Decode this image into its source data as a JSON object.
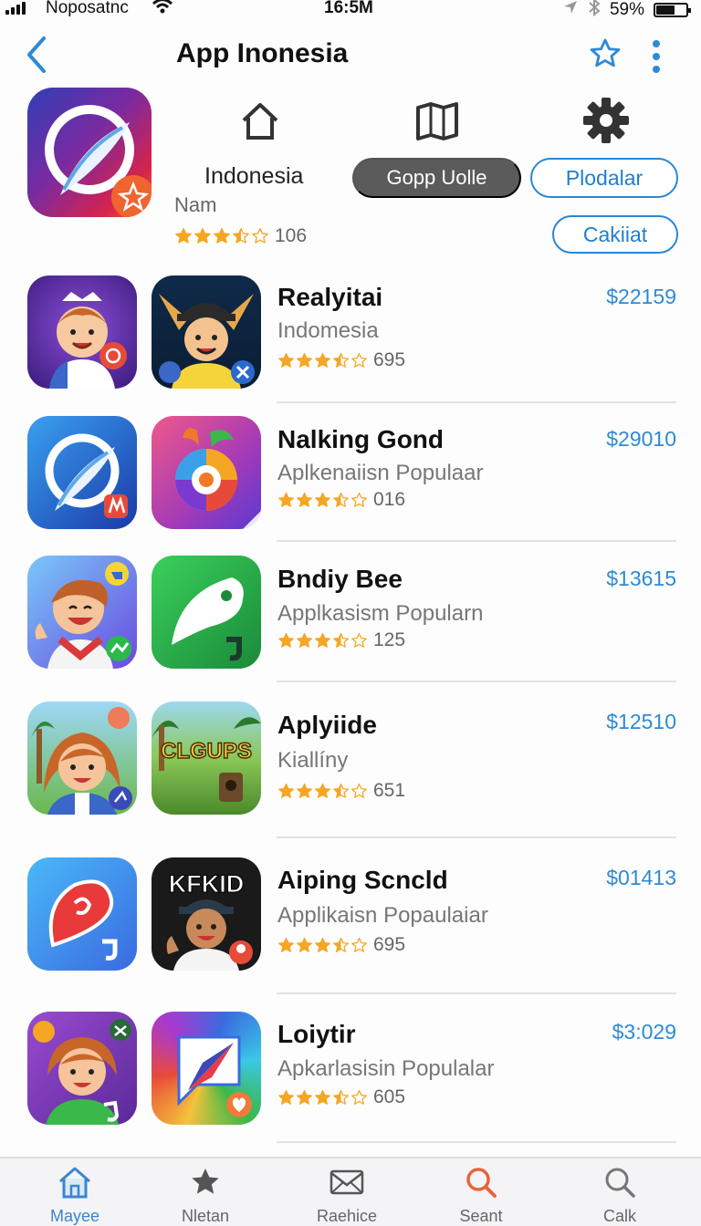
{
  "status_bar": {
    "carrier": "Noposatnc",
    "time": "16:5M",
    "battery": "59%",
    "icons": [
      "signal-icon",
      "wifi-icon",
      "location-icon",
      "bluetooth-icon",
      "battery-icon"
    ]
  },
  "nav": {
    "title": "App Inonesia",
    "icons": [
      "back-chevron-icon",
      "star-outline-icon",
      "more-vertical-icon"
    ]
  },
  "hero": {
    "name": "Indonesia",
    "subtitle": "Nam",
    "rating_count": "106",
    "rating": 3.5,
    "actions": {
      "dark_pill": "Gopp Uolle",
      "primary_outline": "Plodalar",
      "secondary_outline": "Cakiiat"
    },
    "icons": [
      "home-icon",
      "book-icon",
      "gear-icon"
    ]
  },
  "apps": [
    {
      "title": "Realyitai",
      "subtitle": "Indomesia",
      "rating_count": "695",
      "price": "$22159",
      "rating": 3.5
    },
    {
      "title": "Nalking Gond",
      "subtitle": "Aplkenaiisn Populaar",
      "rating_count": "016",
      "price": "$29010",
      "rating": 3.5
    },
    {
      "title": "Bndiy Bee",
      "subtitle": "Applkasism Popularn",
      "rating_count": "125",
      "price": "$13615",
      "rating": 3.5
    },
    {
      "title": "Aplyiide",
      "subtitle": "Kiallíny",
      "rating_count": "651",
      "price": "$12510",
      "rating": 3.5
    },
    {
      "title": "Aiping Scncld",
      "subtitle": "Applikaisn Popaulaiar",
      "rating_count": "695",
      "price": "$01413",
      "rating": 3.5
    },
    {
      "title": "Loiytir",
      "subtitle": "Apkarlasisin Populalar",
      "rating_count": "605",
      "price": "$3:029",
      "rating": 3.5
    }
  ],
  "icon_texts": {
    "clgups": "CLGUPS",
    "kfkid": "KFKID"
  },
  "tabs": [
    {
      "label": "Mayee",
      "icon": "home-icon",
      "active": true
    },
    {
      "label": "Nletan",
      "icon": "star-icon",
      "active": false
    },
    {
      "label": "Raehice",
      "icon": "mail-icon",
      "active": false
    },
    {
      "label": "Seant",
      "icon": "search-icon",
      "active": false
    },
    {
      "label": "Calk",
      "icon": "search-icon",
      "active": false
    }
  ],
  "colors": {
    "accent": "#2e8ad6",
    "star": "#f5a623",
    "tab_active": "#3a85d0",
    "search_orange": "#e8643a"
  }
}
